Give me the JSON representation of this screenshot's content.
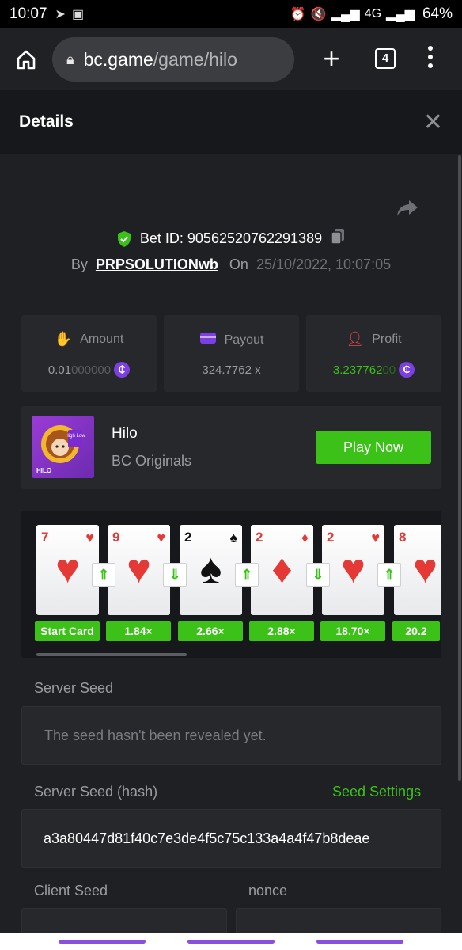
{
  "status_bar": {
    "time": "10:07",
    "battery": "64%",
    "network": "4G"
  },
  "browser": {
    "url_host": "bc.game",
    "url_path": "/game/hilo",
    "tab_count": "4"
  },
  "details": {
    "title": "Details"
  },
  "bet": {
    "id_label": "Bet ID: 90562520762291389",
    "by_label": "By",
    "user": "PRPSOLUTIONwb",
    "on_label": "On",
    "date": "25/10/2022, 10:07:05"
  },
  "stats": {
    "amount": {
      "label": "Amount",
      "value_main": "0.01",
      "value_dim": "000000"
    },
    "payout": {
      "label": "Payout",
      "value": "324.7762 x"
    },
    "profit": {
      "label": "Profit",
      "value_main": "3.237762",
      "value_dim": "00"
    }
  },
  "game": {
    "name": "Hilo",
    "provider": "BC Originals",
    "play_label": "Play Now",
    "thumb_label": "HILO",
    "thumb_badge": "High Low"
  },
  "cards": [
    {
      "rank": "7",
      "suit": "♥",
      "color": "red",
      "mult": "Start Card"
    },
    {
      "rank": "9",
      "suit": "♥",
      "color": "red",
      "mult": "1.84×"
    },
    {
      "rank": "2",
      "suit": "♠",
      "color": "blk",
      "mult": "2.66×"
    },
    {
      "rank": "2",
      "suit": "♦",
      "color": "red",
      "mult": "2.88×"
    },
    {
      "rank": "2",
      "suit": "♥",
      "color": "red",
      "mult": "18.70×"
    },
    {
      "rank": "8",
      "suit": "♥",
      "color": "red",
      "mult": "20.2"
    }
  ],
  "arrows": [
    "⇑",
    "⇓",
    "⇑",
    "⇓",
    "⇑"
  ],
  "seeds": {
    "server_seed_label": "Server Seed",
    "server_seed_value": "The seed hasn't been revealed yet.",
    "server_hash_label": "Server Seed (hash)",
    "seed_settings_label": "Seed Settings",
    "server_hash_value": "a3a80447d81f40c7e3de4f5c75c133a4a4f47b8deae",
    "client_seed_label": "Client Seed",
    "nonce_label": "nonce"
  },
  "colors": {
    "accent_green": "#3bc117",
    "coin_purple": "#7b3fe4",
    "bg": "#1e2024",
    "panel": "#26282c"
  }
}
